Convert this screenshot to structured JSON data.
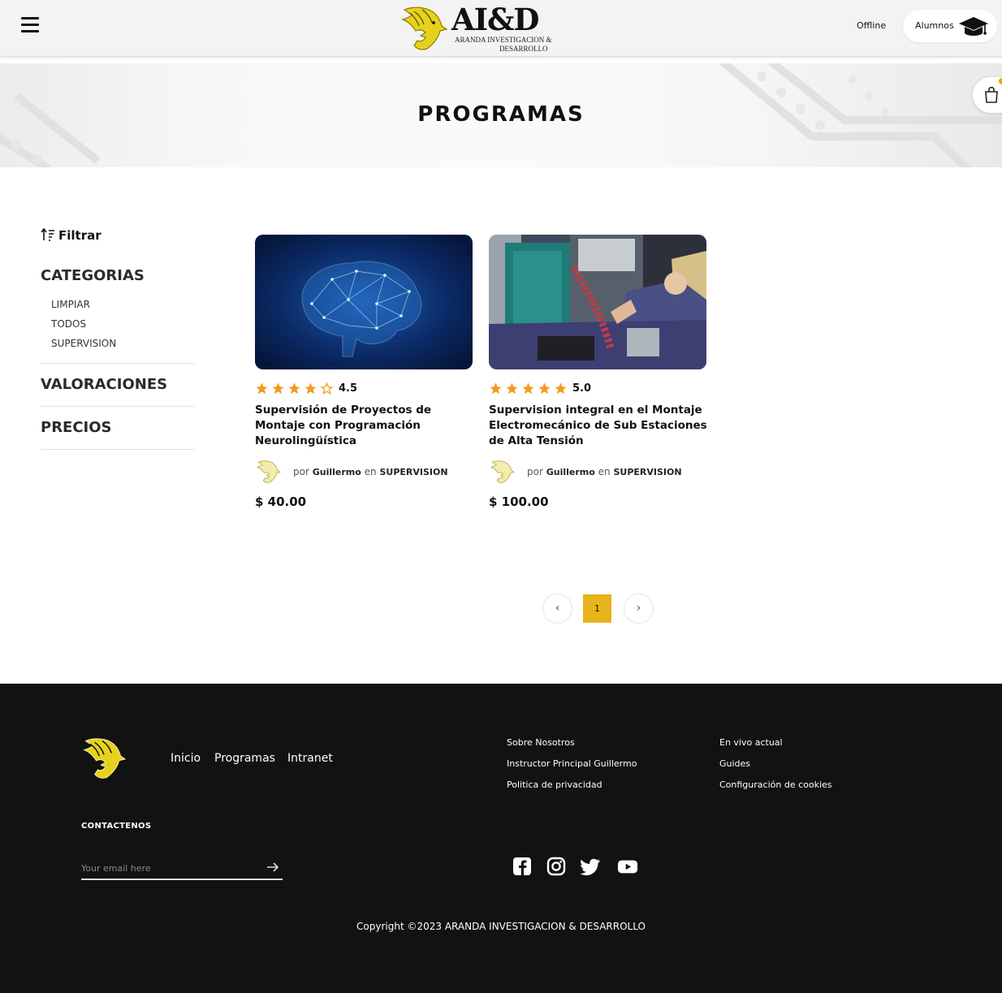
{
  "header": {
    "logo_title": "AI&D",
    "logo_subtitle_1": "ARANDA INVESTIGACION &",
    "logo_subtitle_2": "DESARROLLO",
    "status": "Offline",
    "students_button": "Alumnos"
  },
  "hero": {
    "title": "PROGRAMAS"
  },
  "sidebar": {
    "filter_label": "Filtrar",
    "categories_title": "CATEGORIAS",
    "categories": [
      "LIMPIAR",
      "TODOS",
      "SUPERVISION"
    ],
    "ratings_title": "VALORACIONES",
    "prices_title": "PRECIOS"
  },
  "courses": [
    {
      "rating": "4.5",
      "stars_filled": 4,
      "title": "Supervisión de Proyectos de Montaje con Programación Neurolingüística",
      "by": "por",
      "author": "Guillermo",
      "in": "en",
      "category": "SUPERVISION",
      "price": "$ 40.00"
    },
    {
      "rating": "5.0",
      "stars_filled": 5,
      "title": "Supervision integral en el Montaje Electromecánico de Sub Estaciones de Alta Tensión",
      "by": "por",
      "author": "Guillermo",
      "in": "en",
      "category": "SUPERVISION",
      "price": "$ 100.00"
    }
  ],
  "pagination": {
    "prev": "‹",
    "current": "1",
    "next": "›"
  },
  "footer": {
    "nav": [
      "Inicio",
      "Programas",
      "Intranet"
    ],
    "links_col1": [
      "Sobre Nosotros",
      "Instructor Principal Guillermo",
      "Politica de privacidad"
    ],
    "links_col2": [
      "En vivo actual",
      "Guides",
      "Configuración de cookies"
    ],
    "contact_title": "CONTACTENOS",
    "email_placeholder": "Your email here",
    "social": [
      "facebook-icon",
      "instagram-icon",
      "twitter-icon",
      "youtube-icon"
    ],
    "copyright": "Copyright ©2023 ARANDA INVESTIGACION & DESARROLLO"
  },
  "colors": {
    "accent": "#e8b41c",
    "star": "#f29b1d",
    "footer_bg": "#121212"
  }
}
